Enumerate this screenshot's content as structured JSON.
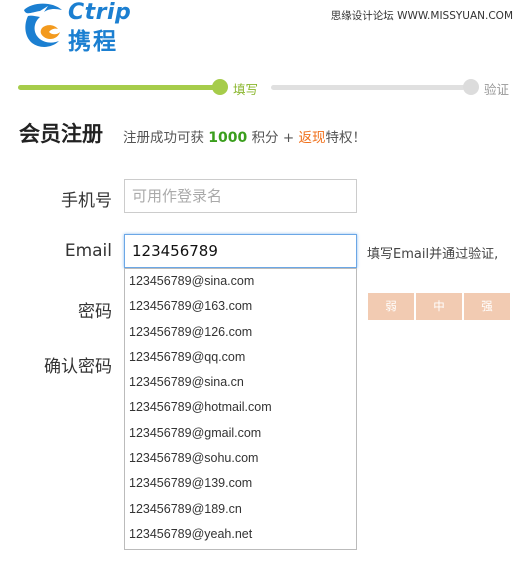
{
  "logo": {
    "brand_en": "Ctrip",
    "brand_cn": "携程"
  },
  "watermark": "思缘设计论坛 WWW.MISSYUAN.COM",
  "steps": [
    {
      "label": "填写",
      "state": "done"
    },
    {
      "label": "验证",
      "state": "todo"
    }
  ],
  "header": {
    "title": "会员注册",
    "subtitle_prefix": "注册成功可获",
    "points": "1000",
    "subtitle_mid": "积分 +",
    "cashback": "返现",
    "subtitle_suffix": "特权！"
  },
  "form": {
    "phone_label": "手机号",
    "phone_placeholder": "可用作登录名",
    "email_label": "Email",
    "email_value": "123456789",
    "email_hint": "填写Email并通过验证,",
    "password_label": "密码",
    "confirm_label": "确认密码",
    "strength": [
      "弱",
      "中",
      "强"
    ]
  },
  "email_suggestions": [
    "123456789@sina.com",
    "123456789@163.com",
    "123456789@126.com",
    "123456789@qq.com",
    "123456789@sina.cn",
    "123456789@hotmail.com",
    "123456789@gmail.com",
    "123456789@sohu.com",
    "123456789@139.com",
    "123456789@189.cn",
    "123456789@yeah.net"
  ],
  "colors": {
    "brand_blue": "#1b7fd1",
    "progress_green": "#a6cc4a",
    "points_green": "#3a9e1c",
    "cashback_orange": "#f0711c",
    "strength_bg": "#f2cbb2"
  }
}
